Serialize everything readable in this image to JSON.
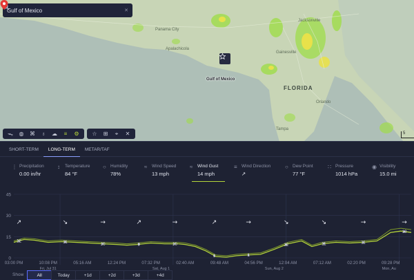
{
  "search": {
    "query": "Gulf of Mexico",
    "icon": "search-icon"
  },
  "map": {
    "pin_label": "Gulf of Mexico",
    "state_label": "FLORIDA",
    "city_labels": [
      "Panama City",
      "Apalachicola",
      "Jacksonville",
      "Gainesville",
      "Orlando",
      "Tampa"
    ],
    "scale_text": "5",
    "colors": {
      "land": "#c9d7b7",
      "water": "#aabfb8",
      "rain_green": "#9fdc4a",
      "rain_yellow": "#e8e14a"
    }
  },
  "toolbar": {
    "layer_icons": [
      "wind-icon",
      "globe-icon",
      "satellite-icon",
      "pin-icon",
      "cloud-icon",
      "layers-icon",
      "settings-icon"
    ],
    "tool_icons": [
      "star-icon",
      "grid-icon",
      "crosshair-icon",
      "close-icon"
    ]
  },
  "tabs": [
    {
      "label": "SHORT-TERM",
      "active": false
    },
    {
      "label": "LONG-TERM",
      "active": true
    },
    {
      "label": "METAR/TAF",
      "active": false
    }
  ],
  "metrics": [
    {
      "label": "Precipitation",
      "value": "0.00 in/hr",
      "icon": "drops-icon",
      "glyph": "⋮"
    },
    {
      "label": "Temperature",
      "value": "84 °F",
      "icon": "thermometer-icon",
      "glyph": "↕"
    },
    {
      "label": "Humidity",
      "value": "78%",
      "icon": "humidity-icon",
      "glyph": "○"
    },
    {
      "label": "Wind Speed",
      "value": "13 mph",
      "icon": "wind-speed-icon",
      "glyph": "≈"
    },
    {
      "label": "Wind Gust",
      "value": "14 mph",
      "icon": "wind-gust-icon",
      "glyph": "≈",
      "active": true
    },
    {
      "label": "Wind Direction",
      "value": "↗",
      "icon": "wind-direction-icon",
      "glyph": "≡"
    },
    {
      "label": "Dew Point",
      "value": "77 °F",
      "icon": "dew-point-icon",
      "glyph": "○"
    },
    {
      "label": "Pressure",
      "value": "1014 hPa",
      "icon": "pressure-icon",
      "glyph": "∷"
    },
    {
      "label": "Visibility",
      "value": "15.0 mi",
      "icon": "visibility-icon",
      "glyph": "◉"
    }
  ],
  "chart_data": {
    "type": "line",
    "yticks": [
      0,
      15,
      30,
      45
    ],
    "ylim": [
      0,
      45
    ],
    "xtick_labels": [
      "03:00 PM",
      "10:08 PM",
      "05:16 AM",
      "12:24 PM",
      "07:32 PM",
      "02:40 AM",
      "09:48 AM",
      "04:56 PM",
      "12:04 AM",
      "07:12 AM",
      "02:20 PM",
      "09:28 PM"
    ],
    "day_labels": [
      "Fri, Jul 31",
      "Sat, Aug 1",
      "Sun, Aug 2",
      "Mon, Au"
    ],
    "xlim": [
      0,
      11.6
    ],
    "series": [
      {
        "x": [
          0,
          0.3,
          0.6,
          1.0,
          1.4,
          1.8,
          2.2,
          2.6,
          3.0,
          3.3,
          3.6,
          4.0,
          4.4,
          4.8,
          5.0,
          5.3,
          5.6,
          5.9,
          6.2,
          6.5,
          6.8,
          7.2,
          7.6,
          8.0,
          8.4,
          8.7,
          9.0,
          9.4,
          9.8,
          10.2,
          10.6,
          11.0,
          11.3,
          11.6
        ],
        "values": [
          11,
          13,
          12.5,
          11,
          11.5,
          11,
          10.5,
          10,
          9.5,
          9,
          9.5,
          10.5,
          10,
          10,
          9.5,
          8,
          5,
          1,
          0.5,
          1.5,
          2,
          2.5,
          6,
          10,
          12,
          8,
          10,
          11,
          10.5,
          11,
          12,
          18,
          19,
          18
        ],
        "labels": [
          {
            "x": 0.15,
            "text": "12"
          },
          {
            "x": 1.5,
            "text": "11"
          },
          {
            "x": 2.6,
            "text": "10"
          },
          {
            "x": 3.65,
            "text": "9"
          },
          {
            "x": 4.7,
            "text": "10"
          },
          {
            "x": 5.85,
            "text": "1"
          },
          {
            "x": 6.85,
            "text": "1"
          },
          {
            "x": 7.95,
            "text": "12"
          },
          {
            "x": 9.05,
            "text": "11"
          },
          {
            "x": 10.2,
            "text": "11"
          },
          {
            "x": 11.4,
            "text": "18"
          }
        ]
      },
      {
        "x": [
          0,
          0.3,
          0.6,
          1.0,
          1.4,
          1.8,
          2.2,
          2.6,
          3.0,
          3.3,
          3.6,
          4.0,
          4.4,
          4.8,
          5.0,
          5.3,
          5.6,
          5.9,
          6.2,
          6.5,
          6.8,
          7.2,
          7.6,
          8.0,
          8.4,
          8.7,
          9.0,
          9.4,
          9.8,
          10.2,
          10.6,
          11.0,
          11.3,
          11.6
        ],
        "values": [
          12,
          14,
          13.5,
          12,
          12.5,
          12,
          11.5,
          11,
          10.5,
          10,
          10.5,
          11.5,
          11,
          11,
          10.5,
          9,
          6,
          2,
          1.5,
          2.5,
          3,
          3.5,
          7,
          11,
          13,
          9,
          11,
          12,
          11.5,
          12,
          13,
          20,
          21,
          20
        ]
      }
    ],
    "direction_arrows": [
      {
        "x": 0.15,
        "glyph": "↗"
      },
      {
        "x": 1.5,
        "glyph": "↘"
      },
      {
        "x": 2.6,
        "glyph": "→"
      },
      {
        "x": 3.65,
        "glyph": "↗"
      },
      {
        "x": 4.7,
        "glyph": "→"
      },
      {
        "x": 5.85,
        "glyph": "↗"
      },
      {
        "x": 6.85,
        "glyph": "→"
      },
      {
        "x": 7.95,
        "glyph": "↘"
      },
      {
        "x": 9.05,
        "glyph": "↘"
      },
      {
        "x": 10.2,
        "glyph": "→"
      },
      {
        "x": 11.4,
        "glyph": "→"
      }
    ],
    "colors": {
      "line": "#b6d63a",
      "line_upper": "#7f9a2a",
      "grid": "#2e3450",
      "axis_text": "#8c91a5"
    }
  },
  "show": {
    "label": "Show",
    "ranges": [
      {
        "label": "All",
        "active": true
      },
      {
        "label": "Today",
        "active": false
      },
      {
        "label": "+1d",
        "active": false
      },
      {
        "label": "+2d",
        "active": false
      },
      {
        "label": "+3d",
        "active": false
      },
      {
        "label": "+4d",
        "active": false
      }
    ]
  }
}
